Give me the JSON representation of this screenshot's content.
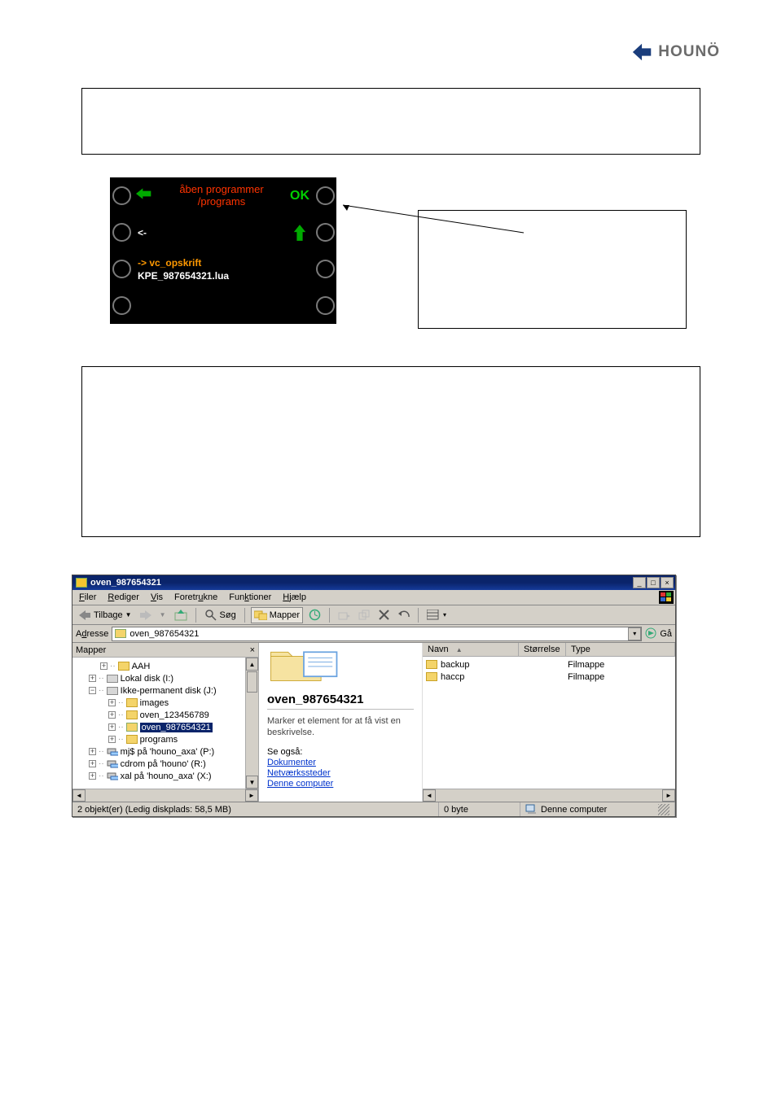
{
  "logo_text": "HOUNÖ",
  "oven_panel": {
    "title_line1": "åben programmer",
    "title_line2": "/programs",
    "ok_label": "OK",
    "row_back": "<-",
    "row_vc": "-> vc_opskrift",
    "row_kpe": "KPE_987654321.lua"
  },
  "explorer": {
    "title": "oven_987654321",
    "menus": {
      "filer": "Filer",
      "filer_u": "F",
      "rediger": "Rediger",
      "rediger_u": "R",
      "vis": "Vis",
      "vis_u": "V",
      "foretrukne": "Foretrukne",
      "foretrukne_u": "u",
      "funktioner": "Funktioner",
      "funktioner_u": "k",
      "hjaelp": "Hjælp",
      "hjaelp_u": "H"
    },
    "toolbar": {
      "tilbage": "Tilbage",
      "sog": "Søg",
      "mapper": "Mapper"
    },
    "addr_label_pre": "A",
    "addr_label_u": "d",
    "addr_label_post": "resse",
    "addr_value": "oven_987654321",
    "go_label": "Gå",
    "folders_header": "Mapper",
    "tree": {
      "aah": "AAH",
      "lokal": "Lokal disk (I:)",
      "ikke": "Ikke-permanent disk (J:)",
      "images": "images",
      "oven1": "oven_123456789",
      "oven2": "oven_987654321",
      "programs": "programs",
      "mjs": "mj$ på 'houno_axa' (P:)",
      "cdrom": "cdrom på 'houno' (R:)",
      "xal": "xal på 'houno_axa' (X:)"
    },
    "info": {
      "title": "oven_987654321",
      "desc": "Marker et element for at få vist en beskrivelse.",
      "see_also": "Se også:",
      "link1": "Dokumenter",
      "link2": "Netværkssteder",
      "link3": "Denne computer"
    },
    "columns": {
      "navn": "Navn",
      "storrelse": "Størrelse",
      "type": "Type"
    },
    "rows": [
      {
        "name": "backup",
        "type": "Filmappe"
      },
      {
        "name": "haccp",
        "type": "Filmappe"
      }
    ],
    "status": {
      "left": "2 objekt(er) (Ledig diskplads: 58,5 MB)",
      "mid": "0 byte",
      "right": "Denne computer"
    }
  }
}
